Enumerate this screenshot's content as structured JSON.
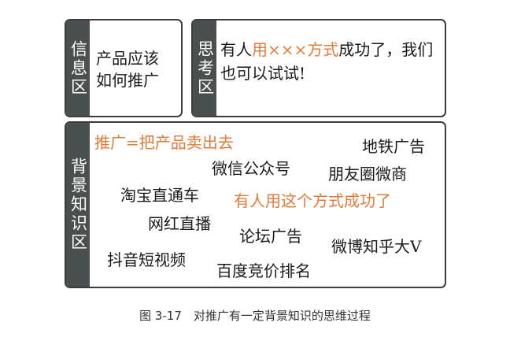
{
  "info_box": {
    "tab_label": "信息区",
    "text_line1": "产品应该",
    "text_line2": "如何推广"
  },
  "think_box": {
    "tab_label": "思考区",
    "prefix": "有人",
    "highlight": "用×××方式",
    "suffix": "成功了，我们也可以试试!"
  },
  "background_box": {
    "tab_label": "背景知识区",
    "items": [
      {
        "text": "推广=把产品卖出去",
        "highlight": true
      },
      {
        "text": "地铁广告",
        "highlight": false
      },
      {
        "text": "微信公众号",
        "highlight": false
      },
      {
        "text": "朋友圈微商",
        "highlight": false
      },
      {
        "text": "淘宝直通车",
        "highlight": false
      },
      {
        "text": "有人用这个方式成功了",
        "highlight": true
      },
      {
        "text": "网红直播",
        "highlight": false
      },
      {
        "text": "论坛广告",
        "highlight": false
      },
      {
        "text": "微博知乎大V",
        "highlight": false
      },
      {
        "text": "抖音短视频",
        "highlight": false
      },
      {
        "text": "百度竞价排名",
        "highlight": false
      }
    ]
  },
  "colors": {
    "accent": "#e07b39",
    "tab": "#4a4f4f",
    "border": "#3a3d3d"
  },
  "caption": "图 3-17　对推广有一定背景知识的思维过程"
}
